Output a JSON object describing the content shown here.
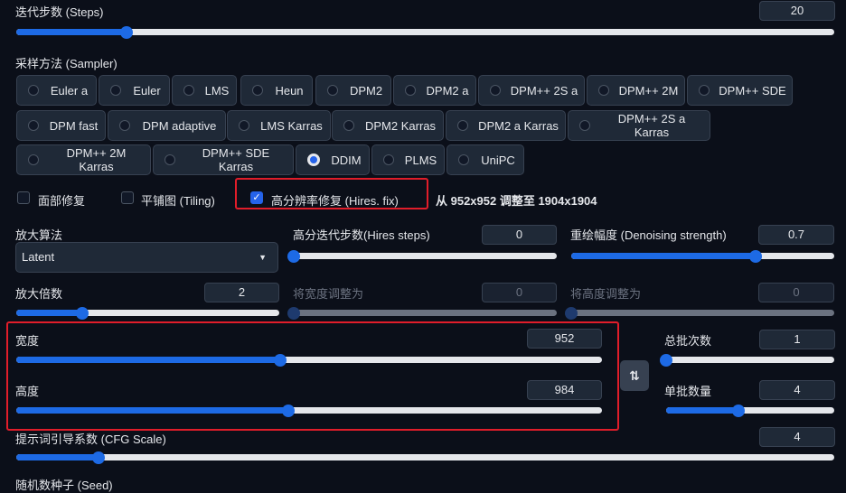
{
  "steps": {
    "label": "迭代步数 (Steps)",
    "value": "20",
    "fraction": 0.135
  },
  "sampler": {
    "label": "采样方法 (Sampler)",
    "selected": "DDIM",
    "options": [
      "Euler a",
      "Euler",
      "LMS",
      "Heun",
      "DPM2",
      "DPM2 a",
      "DPM++ 2S a",
      "DPM++ 2M",
      "DPM++ SDE",
      "DPM fast",
      "DPM adaptive",
      "LMS Karras",
      "DPM2 Karras",
      "DPM2 a Karras",
      "DPM++ 2S a Karras",
      "DPM++ 2M Karras",
      "DPM++ SDE Karras",
      "DDIM",
      "PLMS",
      "UniPC"
    ]
  },
  "checkboxes": {
    "face_restore": {
      "label": "面部修复",
      "checked": false
    },
    "tiling": {
      "label": "平铺图 (Tiling)",
      "checked": false
    },
    "hires_fix": {
      "label": "高分辨率修复 (Hires. fix)",
      "checked": true
    }
  },
  "hires_info": "从 952x952 调整至 1904x1904",
  "upscaler": {
    "label": "放大算法",
    "value": "Latent"
  },
  "hires_steps": {
    "label": "高分迭代步数(Hires steps)",
    "value": "0",
    "fraction": 0.0
  },
  "denoising": {
    "label": "重绘幅度 (Denoising strength)",
    "value": "0.7",
    "fraction": 0.7
  },
  "upscale_by": {
    "label": "放大倍数",
    "value": "2",
    "fraction": 0.25
  },
  "resize_width_to": {
    "label": "将宽度调整为",
    "value": "0",
    "fraction": 0.0
  },
  "resize_height_to": {
    "label": "将高度调整为",
    "value": "0",
    "fraction": 0.0
  },
  "width": {
    "label": "宽度",
    "value": "952",
    "fraction": 0.45
  },
  "height": {
    "label": "高度",
    "value": "984",
    "fraction": 0.465
  },
  "batch_count": {
    "label": "总批次数",
    "value": "1",
    "fraction": 0.0
  },
  "batch_size": {
    "label": "单批数量",
    "value": "4",
    "fraction": 0.43
  },
  "cfg": {
    "label": "提示词引导系数 (CFG Scale)",
    "value": "4",
    "fraction": 0.1
  },
  "seed": {
    "label": "随机数种子 (Seed)"
  },
  "icons": {
    "swap": "swap-vertical-icon",
    "check": "check-icon",
    "caret": "caret-down-icon"
  },
  "colors": {
    "accent": "#1d6ae5",
    "highlight": "#e11d2a",
    "background": "#0b0f19"
  }
}
